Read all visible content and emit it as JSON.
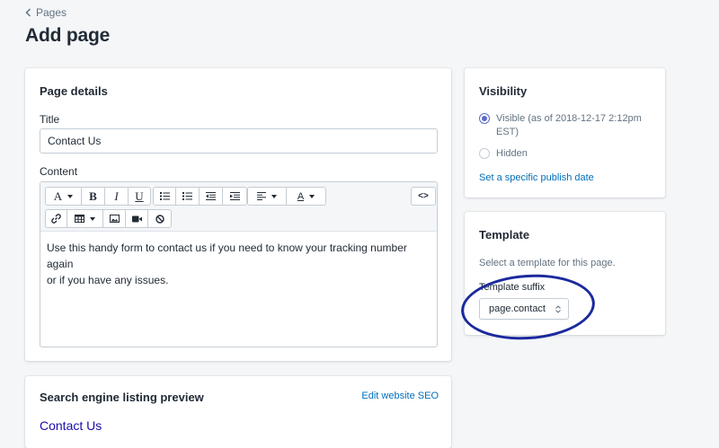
{
  "breadcrumb": {
    "label": "Pages"
  },
  "page_title": "Add page",
  "details": {
    "title": "Page details",
    "title_label": "Title",
    "title_value": "Contact Us",
    "content_label": "Content",
    "content_text_line1": "Use this handy form to contact us if you need to know your tracking number again",
    "content_text_line2": "or if you have any issues.",
    "toolbar": {
      "font": "A",
      "bold": "B",
      "italic": "I",
      "underline": "U",
      "color": "A",
      "html": "<>"
    }
  },
  "seo": {
    "title": "Search engine listing preview",
    "edit_link": "Edit website SEO",
    "preview_title": "Contact Us"
  },
  "visibility": {
    "title": "Visibility",
    "visible_label": "Visible (as of 2018-12-17 2:12pm EST)",
    "hidden_label": "Hidden",
    "selected": "visible",
    "publish_link": "Set a specific publish date"
  },
  "template": {
    "title": "Template",
    "description": "Select a template for this page.",
    "suffix_label": "Template suffix",
    "suffix_value": "page.contact"
  },
  "colors": {
    "accent": "#5c6ac4",
    "link": "#006fbb",
    "annotation": "#1b2a9e"
  }
}
